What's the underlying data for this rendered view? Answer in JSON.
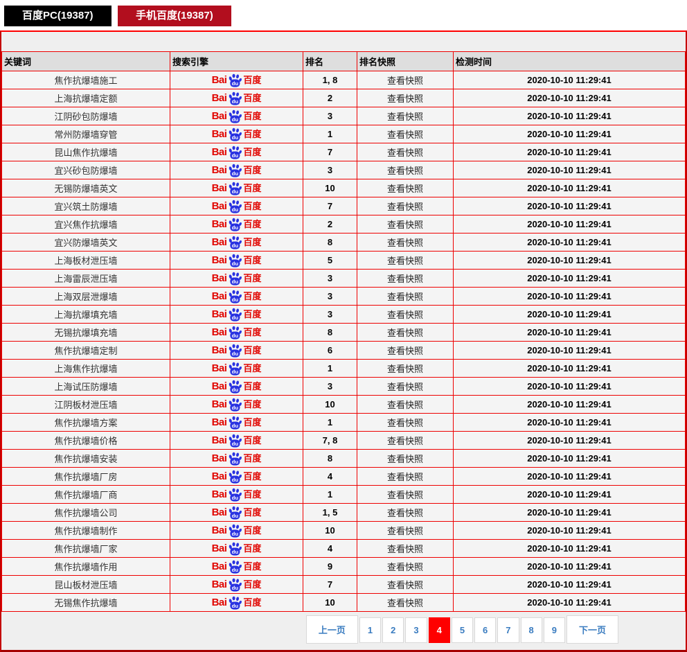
{
  "tabs": [
    {
      "label": "百度PC(19387)",
      "active": false
    },
    {
      "label": "手机百度(19387)",
      "active": true
    }
  ],
  "table": {
    "headers": [
      "关键词",
      "搜索引擎",
      "排名",
      "排名快照",
      "检测时间"
    ],
    "engine": {
      "name": "百度",
      "bai": "Bai",
      "du": "du",
      "cn": "百度"
    },
    "snapshot_label": "查看快照",
    "rows": [
      {
        "kw": "焦作抗爆墙施工",
        "rank": "1, 8",
        "time": "2020-10-10 11:29:41"
      },
      {
        "kw": "上海抗爆墙定额",
        "rank": "2",
        "time": "2020-10-10 11:29:41"
      },
      {
        "kw": "江阴砂包防爆墙",
        "rank": "3",
        "time": "2020-10-10 11:29:41"
      },
      {
        "kw": "常州防爆墙穿管",
        "rank": "1",
        "time": "2020-10-10 11:29:41"
      },
      {
        "kw": "昆山焦作抗爆墙",
        "rank": "7",
        "time": "2020-10-10 11:29:41"
      },
      {
        "kw": "宜兴砂包防爆墙",
        "rank": "3",
        "time": "2020-10-10 11:29:41"
      },
      {
        "kw": "无锡防爆墙英文",
        "rank": "10",
        "time": "2020-10-10 11:29:41"
      },
      {
        "kw": "宜兴筑土防爆墙",
        "rank": "7",
        "time": "2020-10-10 11:29:41"
      },
      {
        "kw": "宜兴焦作抗爆墙",
        "rank": "2",
        "time": "2020-10-10 11:29:41"
      },
      {
        "kw": "宜兴防爆墙英文",
        "rank": "8",
        "time": "2020-10-10 11:29:41"
      },
      {
        "kw": "上海板材泄压墙",
        "rank": "5",
        "time": "2020-10-10 11:29:41"
      },
      {
        "kw": "上海雷辰泄压墙",
        "rank": "3",
        "time": "2020-10-10 11:29:41"
      },
      {
        "kw": "上海双层泄爆墙",
        "rank": "3",
        "time": "2020-10-10 11:29:41"
      },
      {
        "kw": "上海抗爆填充墙",
        "rank": "3",
        "time": "2020-10-10 11:29:41"
      },
      {
        "kw": "无锡抗爆填充墙",
        "rank": "8",
        "time": "2020-10-10 11:29:41"
      },
      {
        "kw": "焦作抗爆墙定制",
        "rank": "6",
        "time": "2020-10-10 11:29:41"
      },
      {
        "kw": "上海焦作抗爆墙",
        "rank": "1",
        "time": "2020-10-10 11:29:41"
      },
      {
        "kw": "上海试压防爆墙",
        "rank": "3",
        "time": "2020-10-10 11:29:41"
      },
      {
        "kw": "江阴板材泄压墙",
        "rank": "10",
        "time": "2020-10-10 11:29:41"
      },
      {
        "kw": "焦作抗爆墙方案",
        "rank": "1",
        "time": "2020-10-10 11:29:41"
      },
      {
        "kw": "焦作抗爆墙价格",
        "rank": "7, 8",
        "time": "2020-10-10 11:29:41"
      },
      {
        "kw": "焦作抗爆墙安装",
        "rank": "8",
        "time": "2020-10-10 11:29:41"
      },
      {
        "kw": "焦作抗爆墙厂房",
        "rank": "4",
        "time": "2020-10-10 11:29:41"
      },
      {
        "kw": "焦作抗爆墙厂商",
        "rank": "1",
        "time": "2020-10-10 11:29:41"
      },
      {
        "kw": "焦作抗爆墙公司",
        "rank": "1, 5",
        "time": "2020-10-10 11:29:41"
      },
      {
        "kw": "焦作抗爆墙制作",
        "rank": "10",
        "time": "2020-10-10 11:29:41"
      },
      {
        "kw": "焦作抗爆墙厂家",
        "rank": "4",
        "time": "2020-10-10 11:29:41"
      },
      {
        "kw": "焦作抗爆墙作用",
        "rank": "9",
        "time": "2020-10-10 11:29:41"
      },
      {
        "kw": "昆山板材泄压墙",
        "rank": "7",
        "time": "2020-10-10 11:29:41"
      },
      {
        "kw": "无锡焦作抗爆墙",
        "rank": "10",
        "time": "2020-10-10 11:29:41"
      }
    ]
  },
  "pagination": {
    "prev": "上一页",
    "pages": [
      "1",
      "2",
      "3",
      "4",
      "5",
      "6",
      "7",
      "8",
      "9"
    ],
    "active_page": "4",
    "next": "下一页"
  },
  "colors": {
    "tab_pc_bg": "#000000",
    "tab_mobile_bg": "#b20e1e",
    "table_border_red": "#ee0000",
    "container_top_red": "#fe0000",
    "container_bottom_red": "#a40000",
    "header_bg": "#dedede",
    "row_bg": "#f4f4f4",
    "baidu_red": "#e10601",
    "baidu_blue": "#2932e1",
    "pagination_link": "#3a7cc0",
    "pagination_active_bg": "#fe0000"
  }
}
